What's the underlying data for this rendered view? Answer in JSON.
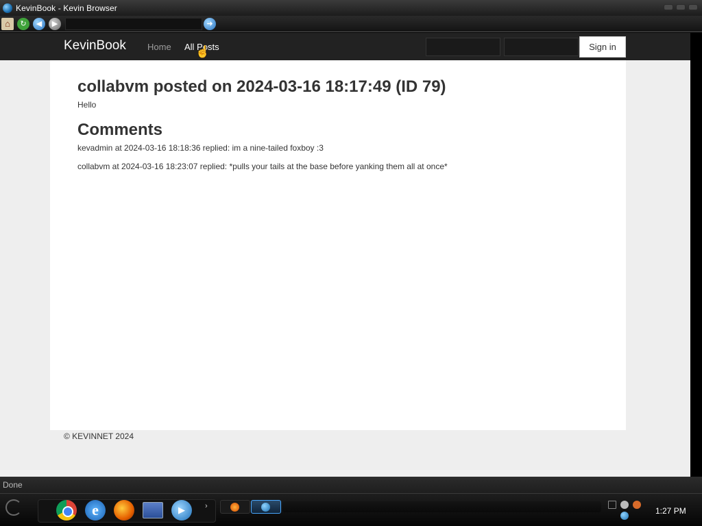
{
  "window": {
    "title": "KevinBook - Kevin Browser"
  },
  "toolbar": {
    "home_icon": "home-icon",
    "refresh_icon": "refresh-icon",
    "back_icon": "back-arrow-icon",
    "forward_icon": "forward-arrow-icon",
    "address_value": "",
    "go_icon": "go-arrow-icon"
  },
  "site": {
    "brand": "KevinBook",
    "nav": [
      {
        "label": "Home"
      },
      {
        "label": "All Posts"
      }
    ],
    "username_value": "",
    "password_value": "",
    "signin_label": "Sign in"
  },
  "post": {
    "title": "collabvm posted on 2024-03-16 18:17:49 (ID 79)",
    "body": "Hello"
  },
  "comments": {
    "heading": "Comments",
    "items": [
      {
        "text": "kevadmin at 2024-03-16 18:18:36 replied: im a nine-tailed foxboy :3"
      },
      {
        "text": "collabvm at 2024-03-16 18:23:07 replied: *pulls your tails at the base before yanking them all at once*"
      }
    ]
  },
  "footer": {
    "text": "© KEVINNET 2024"
  },
  "status": {
    "text": "Done"
  },
  "taskbar": {
    "quick_launch": [
      "chrome-icon",
      "internet-explorer-icon",
      "firefox-icon",
      "window-switcher-icon",
      "media-player-icon"
    ],
    "tasks": [
      "firefox-task",
      "kevin-browser-task"
    ],
    "clock": "1:27 PM"
  },
  "colors": {
    "navbar": "#222222",
    "page_bg": "#eeeeee",
    "content_bg": "#ffffff",
    "text": "#333333"
  }
}
